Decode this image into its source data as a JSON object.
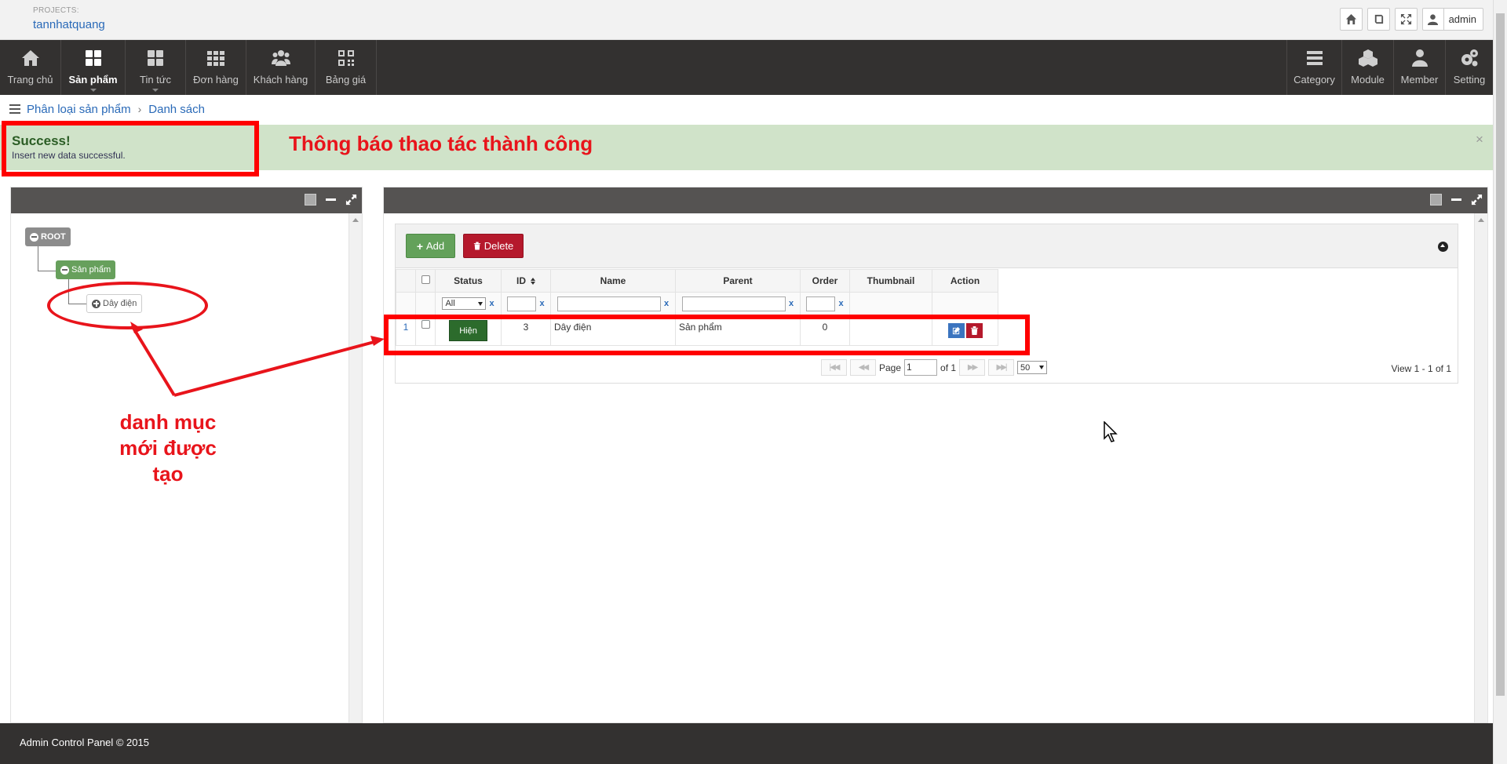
{
  "header": {
    "projects_label": "PROJECTS:",
    "project_name": "tannhatquang",
    "user_name": "admin"
  },
  "nav": {
    "left": [
      {
        "label": "Trang chủ",
        "icon": "home-icon"
      },
      {
        "label": "Sản phẩm",
        "icon": "grid-icon",
        "active": true
      },
      {
        "label": "Tin tức",
        "icon": "grid-icon"
      },
      {
        "label": "Đơn hàng",
        "icon": "grid-dots-icon"
      },
      {
        "label": "Khách hàng",
        "icon": "users-icon"
      },
      {
        "label": "Bảng giá",
        "icon": "qrcode-icon"
      }
    ],
    "right": [
      {
        "label": "Category",
        "icon": "list-icon"
      },
      {
        "label": "Module",
        "icon": "cubes-icon"
      },
      {
        "label": "Member",
        "icon": "user-icon"
      },
      {
        "label": "Setting",
        "icon": "gears-icon"
      }
    ]
  },
  "breadcrumb": [
    "Phân loại sản phẩm",
    "Danh sách"
  ],
  "alert": {
    "title": "Success!",
    "message": "Insert new data successful.",
    "note": "Thông báo thao tác thành công",
    "close": "×"
  },
  "tree": {
    "root": "ROOT",
    "child": "Sản phẩm",
    "leaf": "Dây điện"
  },
  "annotation": "danh mục mới được tạo",
  "toolbar": {
    "add_label": "Add",
    "delete_label": "Delete"
  },
  "table": {
    "columns": [
      "Status",
      "ID",
      "Name",
      "Parent",
      "Order",
      "Thumbnail",
      "Action"
    ],
    "filter_status": "All",
    "filter_clear": "x",
    "rows": [
      {
        "num": "1",
        "status": "Hiện",
        "id": "3",
        "name": "Dây điện",
        "parent": "Sản phẩm",
        "order": "0",
        "thumbnail": ""
      }
    ]
  },
  "pager": {
    "page_label": "Page",
    "page_value": "1",
    "of_label": "of 1",
    "page_size": "50",
    "view_text": "View 1 - 1 of 1"
  },
  "footer": {
    "text": "Admin Control Panel © 2015"
  },
  "colors": {
    "nav_bg": "#333130",
    "alert_bg": "#d0e3c9",
    "add_btn": "#63a15a",
    "delete_btn": "#b5192c",
    "annotation_red": "#e8141b"
  }
}
